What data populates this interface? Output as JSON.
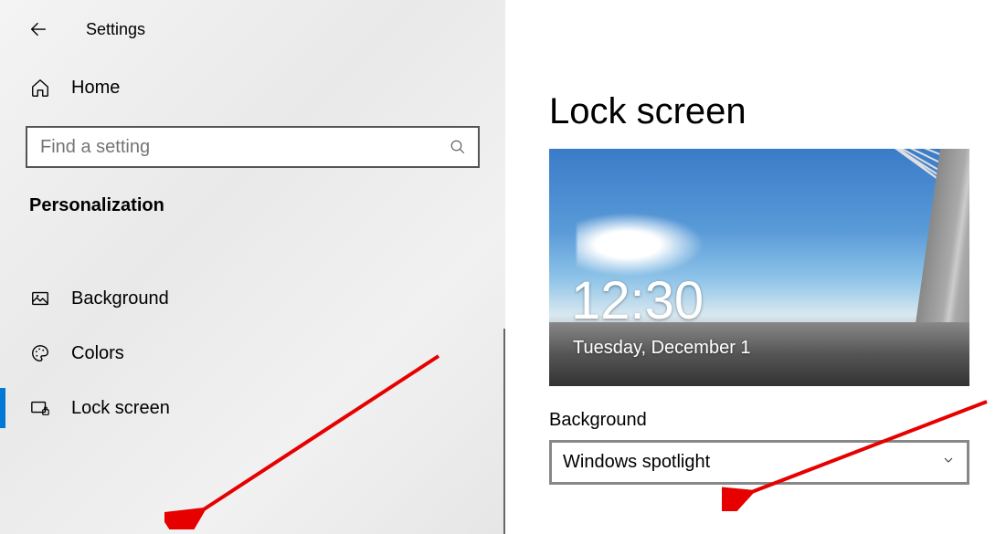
{
  "header": {
    "title": "Settings"
  },
  "nav": {
    "home_label": "Home",
    "section_title": "Personalization",
    "items": [
      {
        "label": "Background"
      },
      {
        "label": "Colors"
      },
      {
        "label": "Lock screen"
      }
    ]
  },
  "search": {
    "placeholder": "Find a setting"
  },
  "page": {
    "title": "Lock screen",
    "preview_time": "12:30",
    "preview_date": "Tuesday, December 1",
    "background_label": "Background",
    "background_value": "Windows spotlight"
  }
}
